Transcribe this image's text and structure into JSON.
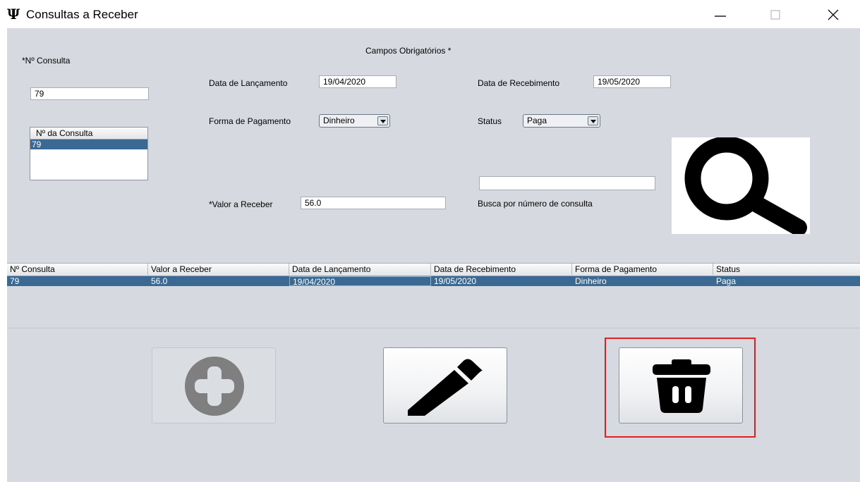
{
  "window": {
    "title": "Consultas a Receber",
    "icon_glyph": "Ψ",
    "controls": [
      "minimize-icon",
      "maximize-icon",
      "close-icon"
    ]
  },
  "form": {
    "required_note": "Campos Obrigatórios *",
    "consulta": {
      "label": "*Nº Consulta",
      "value": "79"
    },
    "consulta_list": {
      "header": "Nº da Consulta",
      "items": [
        "79"
      ],
      "selected": 0
    },
    "data_lancamento": {
      "label": "Data de Lançamento",
      "value": "19/04/2020"
    },
    "data_recebimento": {
      "label": "Data de Recebimento",
      "value": "19/05/2020"
    },
    "forma_pagamento": {
      "label": "Forma de Pagamento",
      "selected": "Dinheiro"
    },
    "status": {
      "label": "Status",
      "selected": "Paga"
    },
    "valor": {
      "label": "*Valor a Receber",
      "value": "56.0"
    },
    "busca": {
      "label": "Busca por número de consulta",
      "value": ""
    },
    "search_image_icon": "search-icon"
  },
  "table": {
    "columns": [
      "Nº Consulta",
      "Valor a Receber",
      "Data de Lançamento",
      "Data de Recebimento",
      "Forma de Pagamento",
      "Status"
    ],
    "rows": [
      [
        "79",
        "56.0",
        "19/04/2020",
        "19/05/2020",
        "Dinheiro",
        "Paga"
      ]
    ],
    "selected_row": 0
  },
  "actions": {
    "add": {
      "icon": "plus-circle-icon",
      "enabled": false
    },
    "edit": {
      "icon": "pencil-icon",
      "enabled": true
    },
    "delete": {
      "icon": "trash-icon",
      "enabled": true,
      "highlighted": true
    }
  },
  "colors": {
    "panel_bg": "#d6d9df",
    "selection_bg": "#3a6a93",
    "highlight_border": "#e02020",
    "disabled_icon": "#7f7f7f"
  }
}
